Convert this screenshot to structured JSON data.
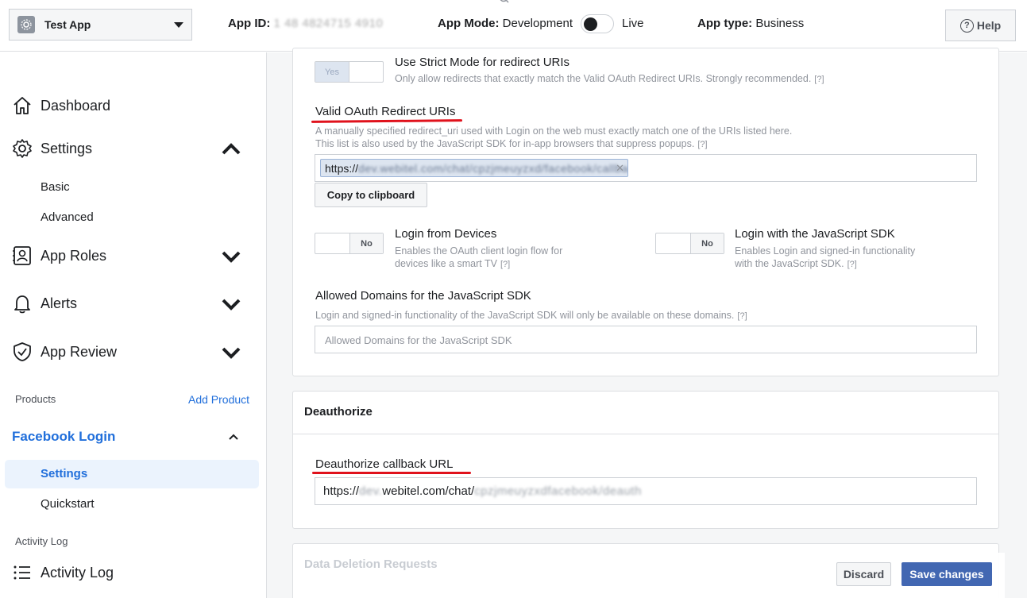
{
  "topbar": {
    "app_name": "Test App",
    "app_id_label": "App ID:",
    "app_id_value": "1 48 4824715 4910",
    "app_mode_label": "App Mode:",
    "app_mode_value": "Development",
    "live_label": "Live",
    "app_type_label": "App type:",
    "app_type_value": "Business",
    "help_label": "Help"
  },
  "sidebar": {
    "dashboard": "Dashboard",
    "settings": "Settings",
    "settings_basic": "Basic",
    "settings_advanced": "Advanced",
    "app_roles": "App Roles",
    "alerts": "Alerts",
    "app_review": "App Review",
    "products_label": "Products",
    "add_product": "Add Product",
    "facebook_login": "Facebook Login",
    "fl_settings": "Settings",
    "fl_quickstart": "Quickstart",
    "activity_log_label": "Activity Log",
    "activity_log": "Activity Log"
  },
  "oauth": {
    "strict_toggle": "Yes",
    "strict_title": "Use Strict Mode for redirect URIs",
    "strict_desc": "Only allow redirects that exactly match the Valid OAuth Redirect URIs. Strongly recommended.",
    "qmark": "[?]",
    "valid_title": "Valid OAuth Redirect URIs",
    "valid_desc_1": "A manually specified redirect_uri used with Login on the web must exactly match one of the URIs listed here.",
    "valid_desc_2": "This list is also used by the JavaScript SDK for in-app browsers that suppress popups.",
    "redirect_uri_prefix": "https://",
    "redirect_uri_masked": "dev.webitel.com/chat/cpzjmeuyzxd/facebook/callback",
    "copy_btn": "Copy to clipboard",
    "devices_toggle": "No",
    "devices_title": "Login from Devices",
    "devices_desc_1": "Enables the OAuth client login flow for",
    "devices_desc_2": "devices like a smart TV",
    "jssdk_toggle": "No",
    "jssdk_title": "Login with the JavaScript SDK",
    "jssdk_desc_1": "Enables Login and signed-in functionality",
    "jssdk_desc_2": "with the JavaScript SDK.",
    "domains_title": "Allowed Domains for the JavaScript SDK",
    "domains_desc": "Login and signed-in functionality of the JavaScript SDK will only be available on these domains.",
    "domains_placeholder": "Allowed Domains for the JavaScript SDK"
  },
  "deauth": {
    "section_title": "Deauthorize",
    "callback_title": "Deauthorize callback URL",
    "callback_prefix": "https://",
    "callback_host": "webitel.com/chat/",
    "callback_masked_1": "dev.",
    "callback_masked_2": "cpzjmeuyzxdfacebook/deauth"
  },
  "footer": {
    "data_deletion": "Data Deletion Requests",
    "discard": "Discard",
    "save": "Save changes"
  },
  "colors": {
    "accent": "#216fdb",
    "save_button": "#4267b2",
    "annotation_underline": "#e0121c"
  }
}
